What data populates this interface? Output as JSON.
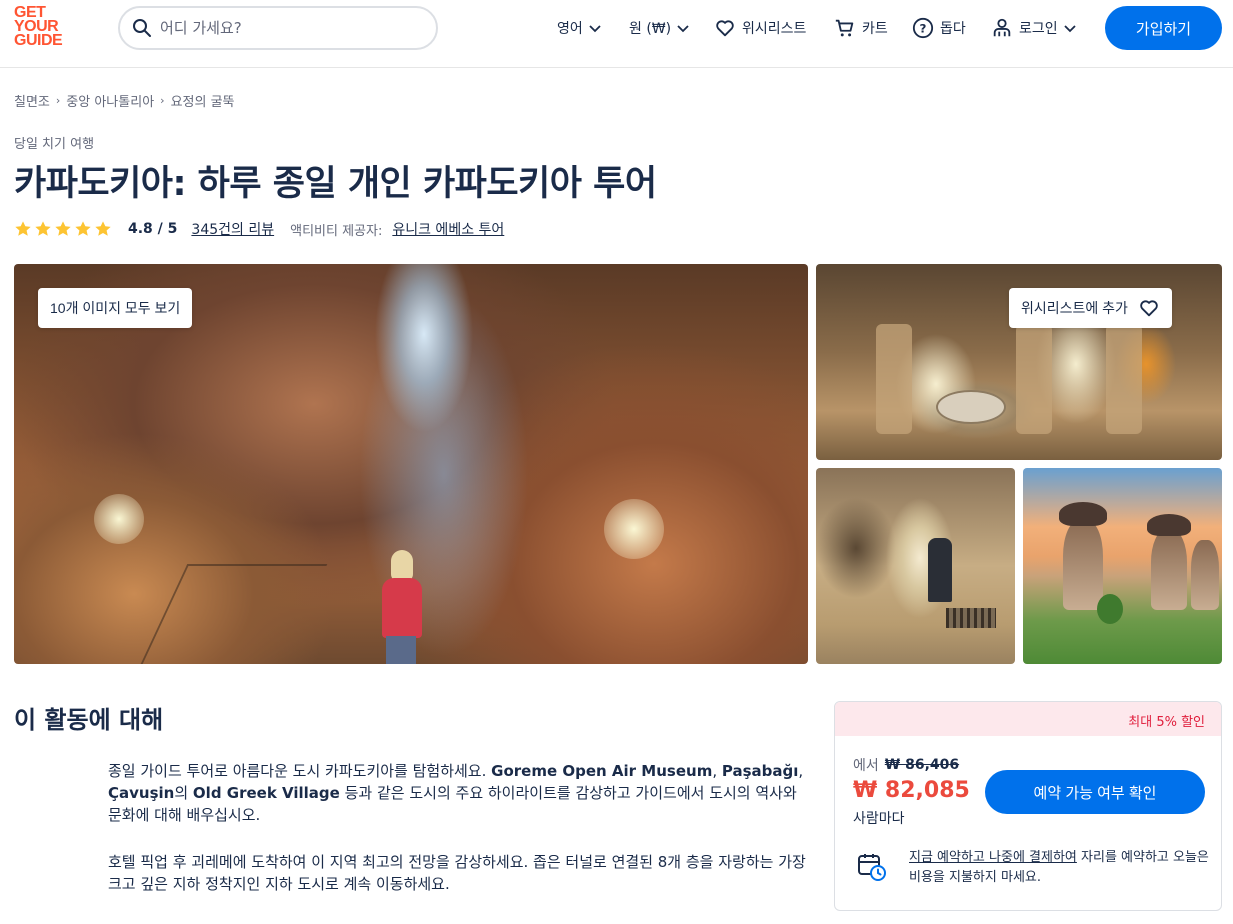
{
  "header": {
    "logo_lines": [
      "GET",
      "YOUR",
      "GUIDE"
    ],
    "search_placeholder": "어디 가세요?",
    "nav": {
      "language": "영어",
      "currency": "원 (₩)",
      "wishlist": "위시리스트",
      "cart": "카트",
      "help": "돕다",
      "login": "로그인"
    },
    "signup_label": "가입하기"
  },
  "breadcrumb": [
    "칠면조",
    "중앙 아나톨리아",
    "요정의 굴뚝"
  ],
  "activity": {
    "category": "당일 치기 여행",
    "title": "카파도키아: 하루 종일 개인 카파도키아 투어",
    "rating_value": "4.8 / 5",
    "stars": 5,
    "reviews_label": "345건의 리뷰",
    "provider_label": "액티비티 제공자:",
    "provider_name": "유니크 에베소 투어"
  },
  "gallery": {
    "view_all_label": "10개 이미지 모두 보기",
    "wishlist_add_label": "위시리스트에 추가"
  },
  "about": {
    "title": "이 활동에 대해",
    "p1_segments": [
      {
        "text": "종일 가이드 투어로 아름다운 도시 카파도키아를 탐험하세요. ",
        "bold": false
      },
      {
        "text": "Goreme Open Air Museum",
        "bold": true
      },
      {
        "text": ", ",
        "bold": false
      },
      {
        "text": "Paşabağı",
        "bold": true
      },
      {
        "text": ", ",
        "bold": false
      },
      {
        "text": "Çavuşin",
        "bold": true
      },
      {
        "text": "의 ",
        "bold": false
      },
      {
        "text": "Old Greek Village",
        "bold": true
      },
      {
        "text": " 등과 같은 도시의 주요 하이라이트를 감상하고 가이드에서 도시의 역사와 문화에 대해 배우십시오.",
        "bold": false
      }
    ],
    "p2": "호텔 픽업 후 괴레메에 도착하여 이 지역 최고의 전망을 감상하세요. 좁은 터널로 연결된 8개 층을 자랑하는 가장 크고 깊은 지하 정착지인 지하 도시로 계속 이동하세요."
  },
  "booking": {
    "discount": "최대 5% 할인",
    "from_label": "에서",
    "old_price": "₩ 86,406",
    "price": "₩ 82,085",
    "per_person": "사람마다",
    "check_label": "예약 가능 여부 확인",
    "rnpl_link": "지금 예약하고 나중에 결제하여",
    "rnpl_rest": " 자리를 예약하고 오늘은 비용을 지불하지 마세요."
  },
  "colors": {
    "brand_orange": "#ff5533",
    "primary_blue": "#0071eb",
    "price_red": "#eb4a3d",
    "star_yellow": "#fdc432",
    "text_dark": "#1a2b49"
  }
}
